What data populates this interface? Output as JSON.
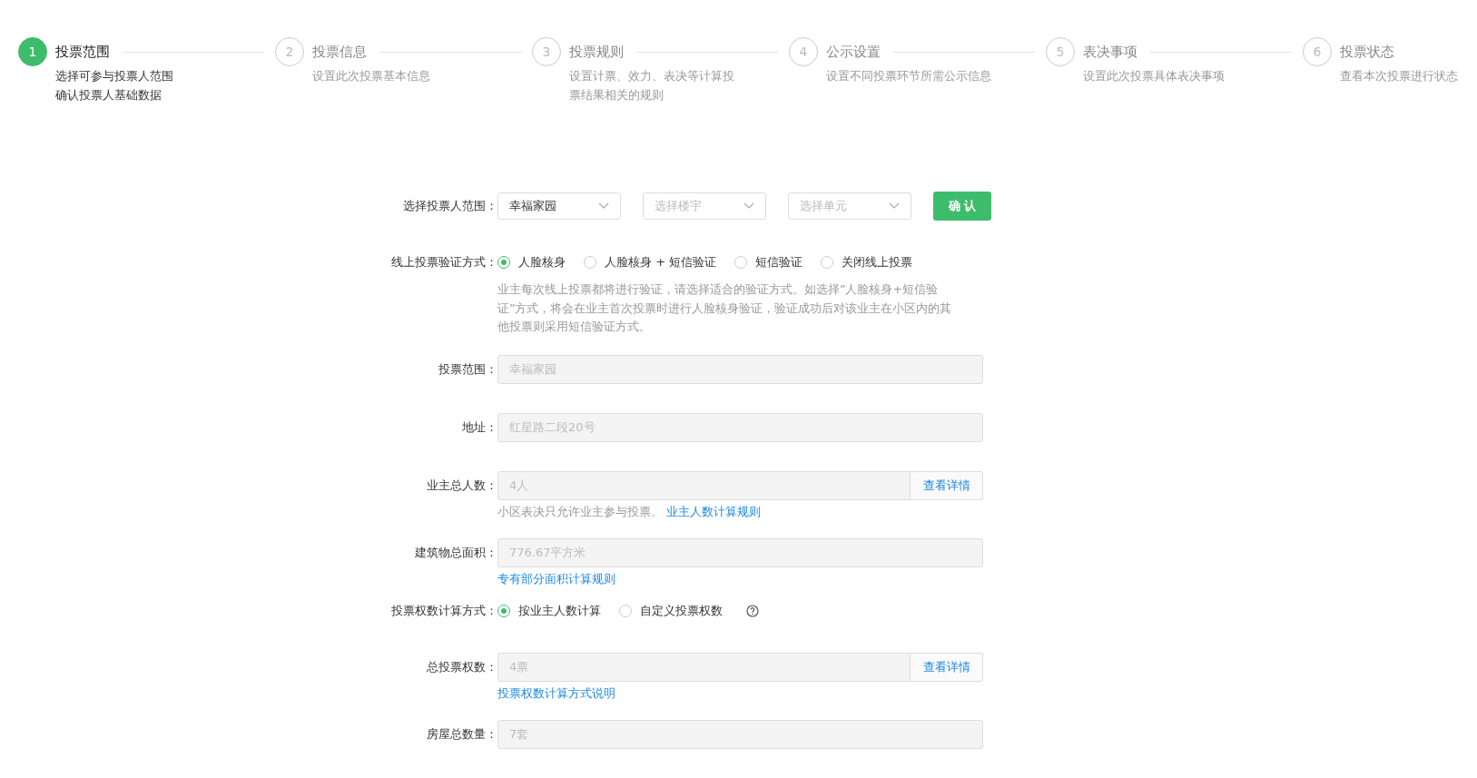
{
  "steps": [
    {
      "number": "1",
      "title": "投票范围",
      "description_lines": [
        "选择可参与投票人范围",
        "确认投票人基础数据"
      ],
      "selected": true
    },
    {
      "number": "2",
      "title": "投票信息",
      "description_lines": [
        "设置此次投票基本信息"
      ],
      "selected": false
    },
    {
      "number": "3",
      "title": "投票规则",
      "description_lines": [
        "设置计票、效力、表决等计算投",
        "票结果相关的规则"
      ],
      "selected": false
    },
    {
      "number": "4",
      "title": "公示设置",
      "description_lines": [
        "设置不同投票环节所需公示信息"
      ],
      "selected": false
    },
    {
      "number": "5",
      "title": "表决事项",
      "description_lines": [
        "设置此次投票具体表决事项"
      ],
      "selected": false
    },
    {
      "number": "6",
      "title": "投票状态",
      "description_lines": [
        "查看本次投票进行状态"
      ],
      "selected": false
    }
  ],
  "form": [
    {
      "kind": "selects",
      "label": "选择投票人范围：",
      "selects": [
        {
          "value": "幸福家园"
        },
        {
          "placeholder": "选择楼宇"
        },
        {
          "placeholder": "选择单元"
        }
      ],
      "button": "确 认"
    },
    {
      "kind": "radios",
      "label": "线上投票验证方式：",
      "options": [
        {
          "label": "人脸核身",
          "selected": true
        },
        {
          "label": "人脸核身 + 短信验证",
          "selected": false
        },
        {
          "label": "短信验证",
          "selected": false
        },
        {
          "label": "关闭线上投票",
          "selected": false
        }
      ],
      "help": "业主每次线上投票都将进行验证，请选择适合的验证方式。如选择”人脸核身+短信验证”方式，将会在业主首次投票时进行人脸核身验证，验证成功后对该业主在小区内的其他投票则采用短信验证方式。"
    },
    {
      "kind": "input",
      "label": "投票范围：",
      "placeholder": "幸福家园"
    },
    {
      "kind": "input",
      "label": "地址：",
      "placeholder": "红星路二段20号"
    },
    {
      "kind": "input",
      "label": "业主总人数：",
      "placeholder": "4人",
      "button": "查看详情",
      "hint": "小区表决只允许业主参与投票。",
      "hint_link": "业主人数计算规则"
    },
    {
      "kind": "input",
      "label": "建筑物总面积：",
      "placeholder": "776.67平方米",
      "hint_link": "专有部分面积计算规则"
    },
    {
      "kind": "radios",
      "label": "投票权数计算方式：",
      "options": [
        {
          "label": "按业主人数计算",
          "selected": true
        },
        {
          "label": "自定义投票权数",
          "selected": false
        }
      ],
      "help_icon": true
    },
    {
      "kind": "input",
      "label": "总投票权数：",
      "placeholder": "4票",
      "button": "查看详情",
      "hint_link": "投票权数计算方式说明"
    },
    {
      "kind": "input",
      "label": "房屋总数量：",
      "placeholder": "7套"
    }
  ]
}
